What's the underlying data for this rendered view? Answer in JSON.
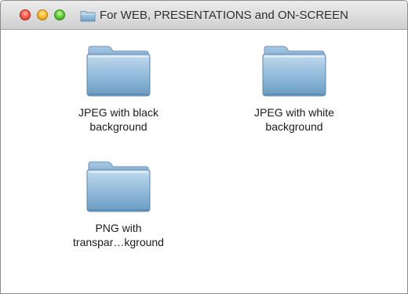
{
  "window": {
    "title": "For WEB, PRESENTATIONS and ON-SCREEN",
    "buttons": {
      "close": "close",
      "minimize": "minimize",
      "zoom": "zoom"
    },
    "icon": "folder-icon"
  },
  "items": [
    {
      "line1": "JPEG with black",
      "line2": "background",
      "icon": "folder-icon"
    },
    {
      "line1": "JPEG with white",
      "line2": "background",
      "icon": "folder-icon"
    },
    {
      "line1": "PNG with",
      "line2": "transpar…kground",
      "icon": "folder-icon"
    }
  ],
  "colors": {
    "folder_top": "#b9d3e6",
    "folder_bottom": "#6f9fc4",
    "folder_tab": "#8db4d4",
    "titlebar_text": "#2b2b2b"
  }
}
